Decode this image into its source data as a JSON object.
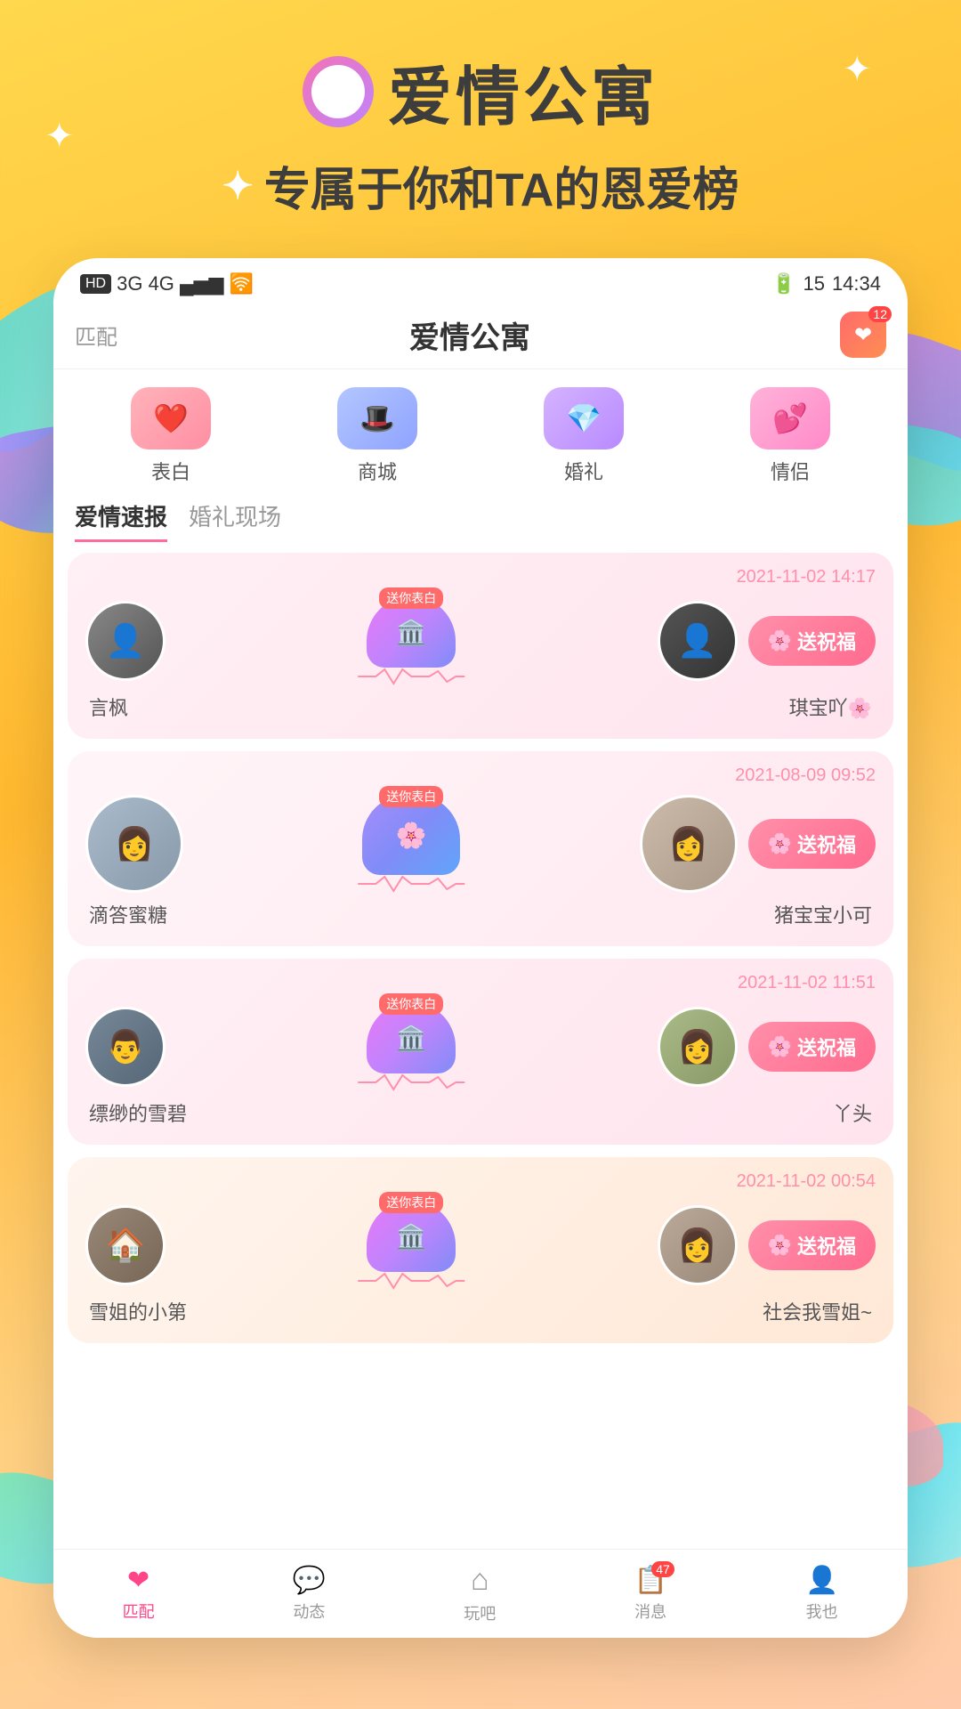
{
  "app": {
    "title": "爱情公寓",
    "subtitle": "专属于你和TA的恩爱榜",
    "ring_icon": "○"
  },
  "status_bar": {
    "left": "HD 2  3G  4G  WiFi",
    "hd_badge": "HD",
    "time": "14:34",
    "battery": "15"
  },
  "nav": {
    "match_label": "匹配",
    "title": "爱情公寓",
    "icon_badge": "12"
  },
  "quick_actions": [
    {
      "id": "confess",
      "label": "表白",
      "icon": "❤️",
      "style": "confess"
    },
    {
      "id": "shop",
      "label": "商城",
      "icon": "🎩",
      "style": "shop"
    },
    {
      "id": "wedding",
      "label": "婚礼",
      "icon": "💎",
      "style": "wedding"
    },
    {
      "id": "couple",
      "label": "情侣",
      "icon": "💕",
      "style": "couple"
    }
  ],
  "tabs": [
    {
      "id": "news",
      "label": "爱情速报",
      "active": true
    },
    {
      "id": "wedding",
      "label": "婚礼现场",
      "active": false
    }
  ],
  "couples": [
    {
      "id": 1,
      "date": "2021-11-02 14:17",
      "person1": {
        "name": "言枫",
        "avatar_color": "#888"
      },
      "person2": {
        "name": "琪宝吖🌸",
        "avatar_color": "#555"
      },
      "blessing_btn": "送祝福"
    },
    {
      "id": 2,
      "date": "2021-08-09 09:52",
      "person1": {
        "name": "滴答蜜糖",
        "avatar_color": "#AAB"
      },
      "person2": {
        "name": "猪宝宝小可",
        "avatar_color": "#CC9"
      },
      "blessing_btn": "送祝福"
    },
    {
      "id": 3,
      "date": "2021-11-02 11:51",
      "person1": {
        "name": "缥缈的雪碧",
        "avatar_color": "#778"
      },
      "person2": {
        "name": "丫头",
        "avatar_color": "#AA8"
      },
      "blessing_btn": "送祝福"
    },
    {
      "id": 4,
      "date": "2021-11-02 00:54",
      "person1": {
        "name": "雪姐的小第",
        "avatar_color": "#998"
      },
      "person2": {
        "name": "社会我雪姐~",
        "avatar_color": "#BB9"
      },
      "blessing_btn": "送祝福"
    }
  ],
  "bottom_nav": [
    {
      "id": "home",
      "label": "匹配",
      "icon": "❤",
      "active": true
    },
    {
      "id": "dynamic",
      "label": "动态",
      "icon": "💬",
      "active": false
    },
    {
      "id": "play",
      "label": "玩吧",
      "icon": "⌂",
      "active": false
    },
    {
      "id": "message",
      "label": "消息",
      "icon": "📋",
      "active": false,
      "badge": "47"
    },
    {
      "id": "profile",
      "label": "我也",
      "icon": "👤",
      "active": false
    }
  ],
  "wedding_arch_badge": "送你表白",
  "sparkle_char": "✦"
}
